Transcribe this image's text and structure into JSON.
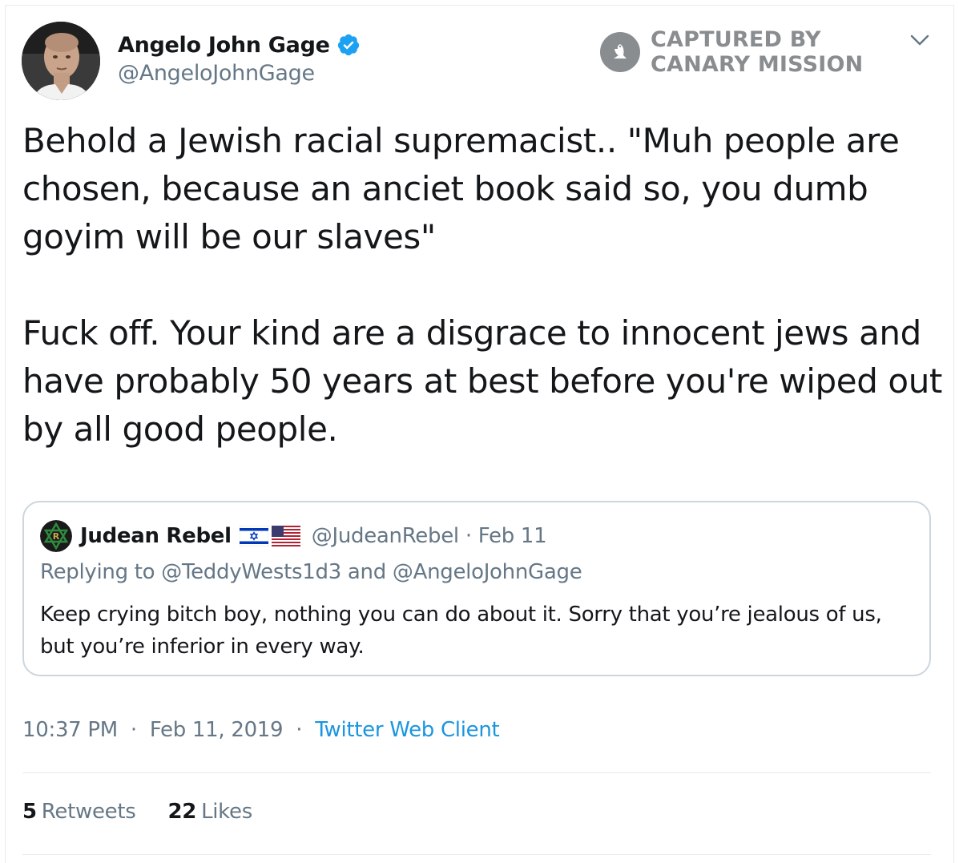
{
  "tweet": {
    "author": {
      "name": "Angelo John Gage",
      "handle": "@AngeloJohnGage",
      "verified": true
    },
    "paragraphs": [
      "Behold a Jewish racial supremacist.. \"Muh people are chosen, because an anciet book said so, you dumb goyim will be our slaves\"",
      "Fuck off. Your kind are a disgrace to innocent jews and have probably 50 years at best before you're wiped out by all good people."
    ],
    "quoted": {
      "name": "Judean Rebel",
      "flags": [
        "israel-flag-icon",
        "us-flag-icon"
      ],
      "handle": "@JudeanRebel",
      "separator": "·",
      "date": "Feb 11",
      "replying_to": "Replying to @TeddyWests1d3 and @AngeloJohnGage",
      "text": "Keep crying bitch boy, nothing you can do about it. Sorry that you’re jealous of us, but you’re inferior in every way."
    },
    "meta": {
      "time": "10:37 PM",
      "date": "Feb 11, 2019",
      "separator": "·",
      "client": "Twitter Web Client"
    },
    "stats": {
      "retweets_count": "5",
      "retweets_label": "Retweets",
      "likes_count": "22",
      "likes_label": "Likes"
    }
  },
  "watermark": {
    "line1": "CAPTURED BY",
    "line2": "CANARY MISSION"
  },
  "colors": {
    "text": "#14171a",
    "secondary": "#657786",
    "link": "#1b95e0",
    "verified": "#1da1f2",
    "border": "#ccd6dd",
    "divider": "#e6ecf0",
    "watermark": "#8a8d90"
  }
}
